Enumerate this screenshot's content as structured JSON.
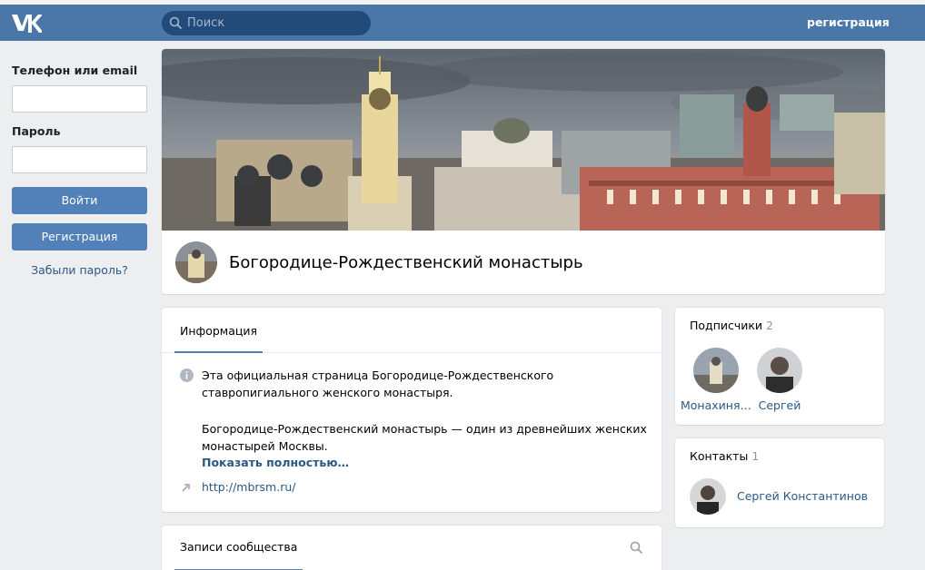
{
  "header": {
    "logo_icon": "vk-logo-icon",
    "search_placeholder": "Поиск",
    "register_link": "регистрация",
    "bg_color": "#4a76a8"
  },
  "login": {
    "phone_label": "Телефон или email",
    "phone_value": "",
    "password_label": "Пароль",
    "password_value": "",
    "login_button": "Войти",
    "register_button": "Регистрация",
    "forgot_link": "Забыли пароль?"
  },
  "community": {
    "name": "Богородице-Рождественский монастырь"
  },
  "info": {
    "tab_label": "Информация",
    "paragraph1": "Эта официальная страница Богородице-Рождественского ставропигиального женского монастыря.",
    "paragraph2": "Богородице-Рождественский монастырь — один из древнейших женских монастырей Москвы.",
    "show_more": "Показать полностью…",
    "website": "http://mbrsm.ru/"
  },
  "subscribers": {
    "title": "Подписчики",
    "count": "2",
    "items": [
      {
        "name": "Монахиня…"
      },
      {
        "name": "Сергей"
      }
    ]
  },
  "contacts": {
    "title": "Контакты",
    "count": "1",
    "items": [
      {
        "name": "Сергей Константинов"
      }
    ]
  },
  "posts": {
    "tab_label": "Записи сообщества"
  }
}
